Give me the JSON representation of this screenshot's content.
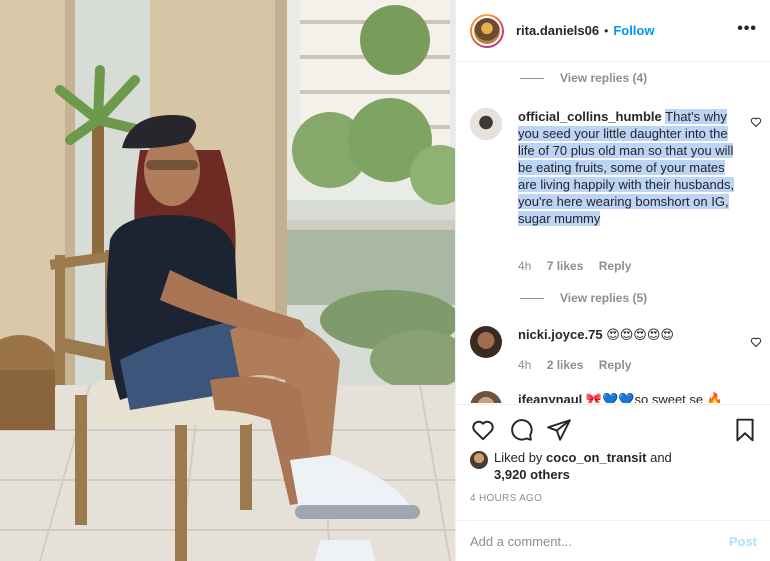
{
  "header": {
    "username": "rita.daniels06",
    "separator": "•",
    "follow_label": "Follow",
    "more_label": "•••"
  },
  "comments": {
    "view_replies_top": "View replies (4)",
    "items": [
      {
        "username": "official_collins_humble",
        "text": "That's why you seed your little daughter into the life of 70 plus old man so that you will be eating fruits, some of your mates are living happily with their husbands, you're here wearing bomshort on IG, sugar mummy",
        "time": "4h",
        "likes": "7 likes",
        "reply_label": "Reply",
        "view_replies": "View replies (5)"
      },
      {
        "username": "nicki.joyce.75",
        "text": "😍😍😍😍😍",
        "time": "4h",
        "likes": "2 likes",
        "reply_label": "Reply"
      },
      {
        "username": "ifeanynaul",
        "text": "🎀💙💙so sweet se 🔥"
      }
    ]
  },
  "likes": {
    "prefix": "Liked by",
    "user": "coco_on_transit",
    "and": "and",
    "count": "3,920 others"
  },
  "time_ago": "4 HOURS AGO",
  "add_comment": {
    "placeholder": "Add a comment...",
    "post_label": "Post"
  },
  "colors": {
    "accent": "#0095f6",
    "post_disabled": "#b2dffc",
    "highlight": "#bcd4f6",
    "muted": "#8e8e8e"
  },
  "icons": [
    "heart-icon",
    "comment-icon",
    "share-icon",
    "bookmark-icon",
    "more-icon"
  ]
}
